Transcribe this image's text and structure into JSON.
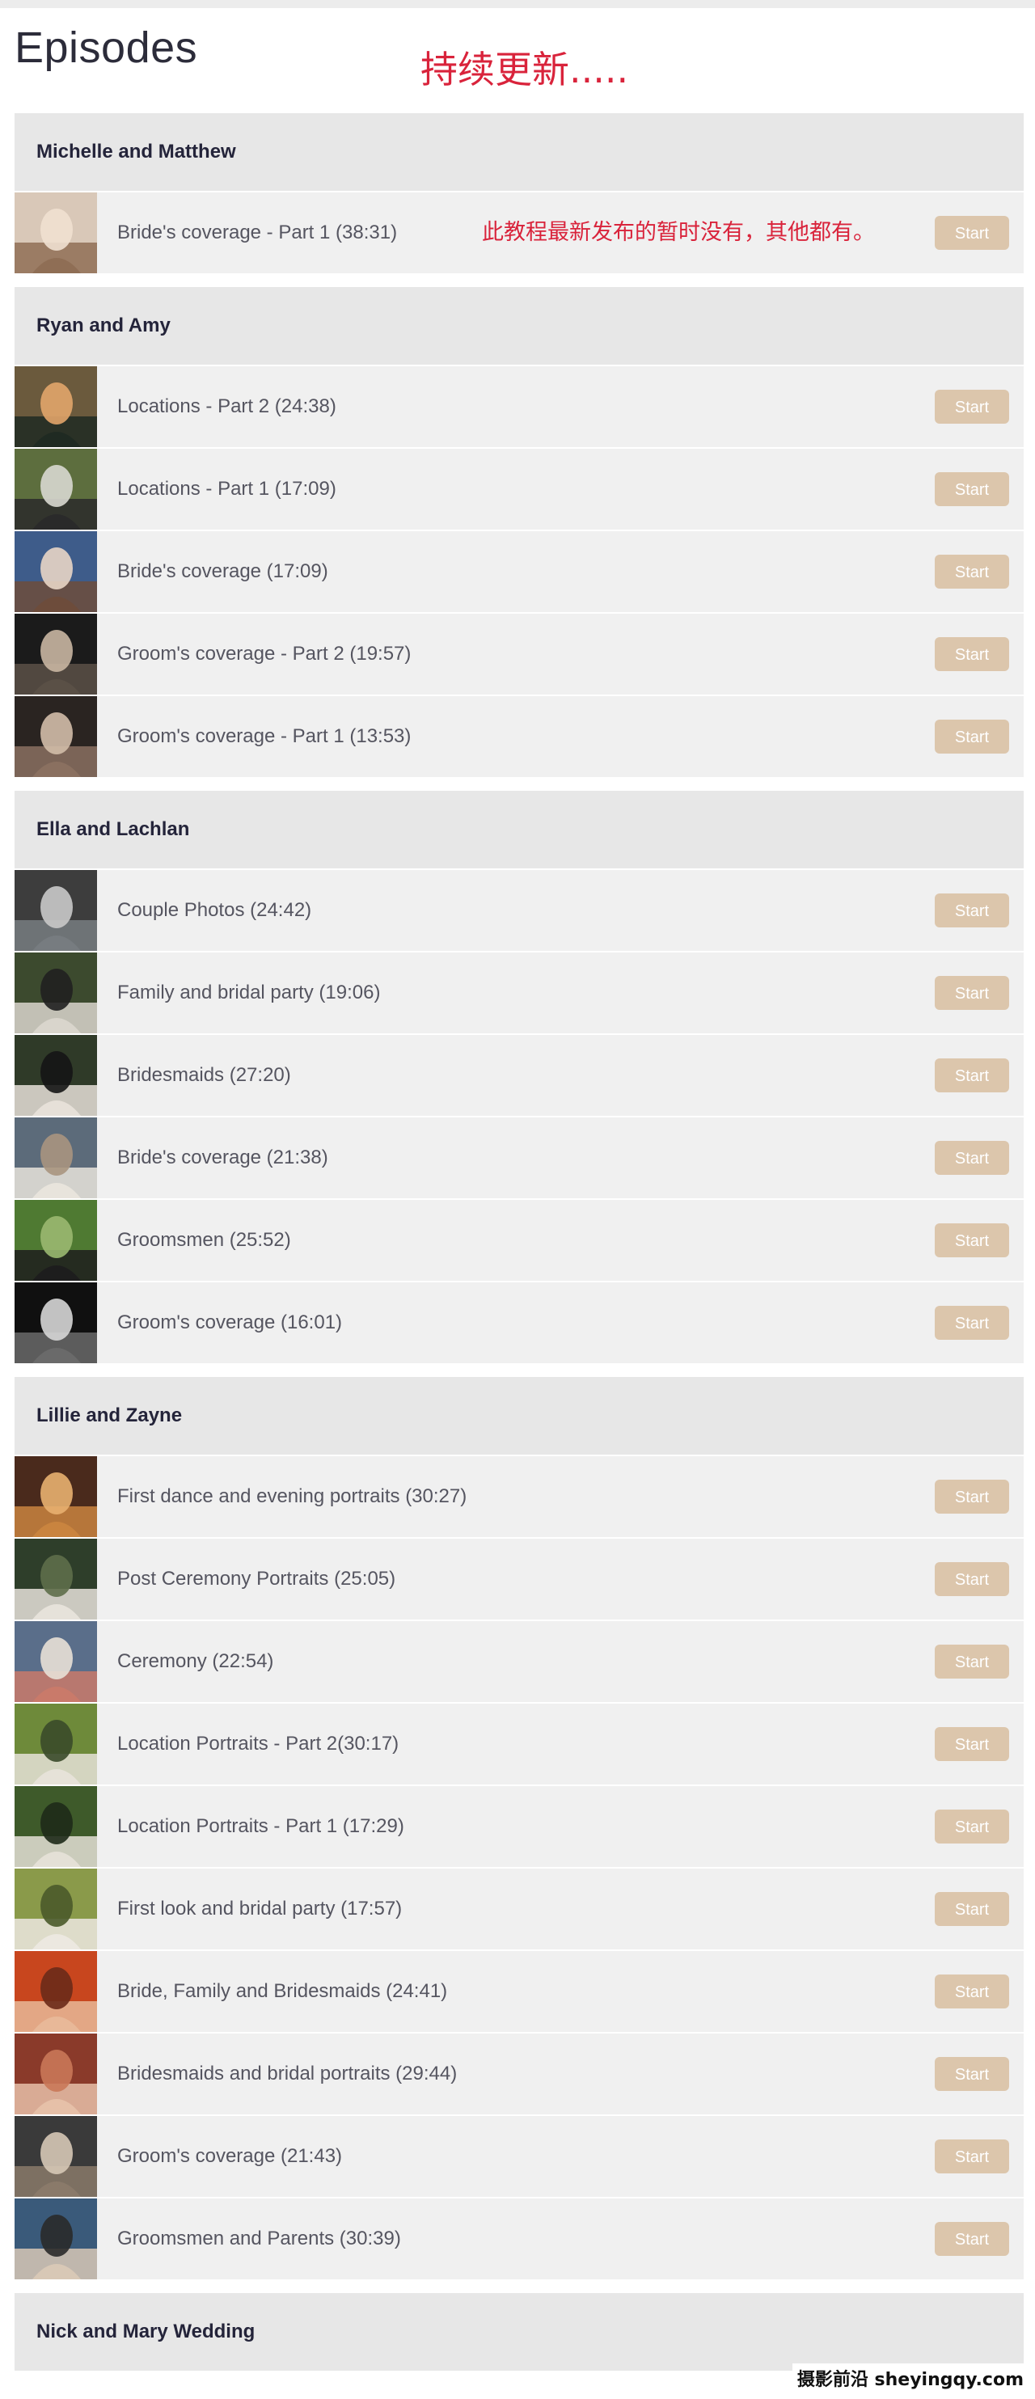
{
  "page": {
    "title": "Episodes",
    "overlay_note": "持续更新.....",
    "watermark": "摄影前沿 sheyingqy.com"
  },
  "colors": {
    "start_button_bg": "#dcc6ac",
    "group_header_bg": "#e7e7e7",
    "row_bg": "#f0f0f0",
    "note_red": "#d9233b"
  },
  "start_label": "Start",
  "groups": [
    {
      "title": "Michelle and Matthew",
      "episodes": [
        {
          "title": "Bride's coverage - Part 1 (38:31)",
          "note": "此教程最新发布的暂时没有，其他都有。",
          "thumb": [
            "#d9c8b8",
            "#8f6e55",
            "#f0e0d0"
          ]
        }
      ]
    },
    {
      "title": "Ryan and Amy",
      "episodes": [
        {
          "title": "Locations - Part 2 (24:38)",
          "thumb": [
            "#6b5a3d",
            "#1f2a22",
            "#e2a56a"
          ]
        },
        {
          "title": "Locations - Part 1 (17:09)",
          "thumb": [
            "#5d6e3e",
            "#2a2a2a",
            "#d8d8d0"
          ]
        },
        {
          "title": "Bride's coverage (17:09)",
          "thumb": [
            "#3e5c8a",
            "#6d4c3b",
            "#e8d5c5"
          ]
        },
        {
          "title": "Groom's coverage - Part 2 (19:57)",
          "thumb": [
            "#1b1b1b",
            "#5a5046",
            "#c9b6a2"
          ]
        },
        {
          "title": "Groom's coverage - Part 1 (13:53)",
          "thumb": [
            "#2a2421",
            "#8a7060",
            "#d2bca8"
          ]
        }
      ]
    },
    {
      "title": "Ella and Lachlan",
      "episodes": [
        {
          "title": "Couple Photos (24:42)",
          "thumb": [
            "#3d3d3d",
            "#777c80",
            "#c9c9c9"
          ]
        },
        {
          "title": "Family and bridal party (19:06)",
          "thumb": [
            "#3c4a2e",
            "#d9d5cc",
            "#202020"
          ]
        },
        {
          "title": "Bridesmaids (27:20)",
          "thumb": [
            "#2f3a28",
            "#e6e0d8",
            "#151515"
          ]
        },
        {
          "title": "Bride's coverage (21:38)",
          "thumb": [
            "#5c6b7a",
            "#e8e4dc",
            "#a89580"
          ]
        },
        {
          "title": "Groomsmen (25:52)",
          "thumb": [
            "#4f7a32",
            "#1d1d1d",
            "#9ab870"
          ]
        },
        {
          "title": "Groom's coverage (16:01)",
          "thumb": [
            "#101010",
            "#6a6a6a",
            "#d6d6d6"
          ]
        }
      ]
    },
    {
      "title": "Lillie and Zayne",
      "episodes": [
        {
          "title": "First dance and evening portraits (30:27)",
          "thumb": [
            "#4a2a1c",
            "#c9843f",
            "#e8b070"
          ]
        },
        {
          "title": "Post Ceremony Portraits (25:05)",
          "thumb": [
            "#2e3e2a",
            "#e6e2da",
            "#5e6e4a"
          ]
        },
        {
          "title": "Ceremony (22:54)",
          "thumb": [
            "#5a6e8a",
            "#c97a6a",
            "#e8e0d6"
          ]
        },
        {
          "title": "Location Portraits - Part 2(30:17)",
          "thumb": [
            "#6e8a3a",
            "#e6e2d8",
            "#3a4a2a"
          ]
        },
        {
          "title": "Location Portraits - Part 1 (17:29)",
          "thumb": [
            "#3e5a2a",
            "#e4e0d6",
            "#1e2a18"
          ]
        },
        {
          "title": "First look and bridal party (17:57)",
          "thumb": [
            "#8a9a4a",
            "#ece8e0",
            "#4a5a2a"
          ]
        },
        {
          "title": "Bride, Family and Bridesmaids (24:41)",
          "thumb": [
            "#c8461e",
            "#e8b898",
            "#6a2a18"
          ]
        },
        {
          "title": "Bridesmaids and bridal portraits (29:44)",
          "thumb": [
            "#8a3a2a",
            "#e6c0a8",
            "#c97858"
          ]
        },
        {
          "title": "Groom's coverage (21:43)",
          "thumb": [
            "#3a3a3a",
            "#8a7a6a",
            "#d6c8b6"
          ]
        },
        {
          "title": "Groomsmen and Parents (30:39)",
          "thumb": [
            "#3a5a7a",
            "#d8c8b6",
            "#2a2a2a"
          ]
        }
      ]
    },
    {
      "title": "Nick and Mary Wedding",
      "episodes": []
    }
  ]
}
